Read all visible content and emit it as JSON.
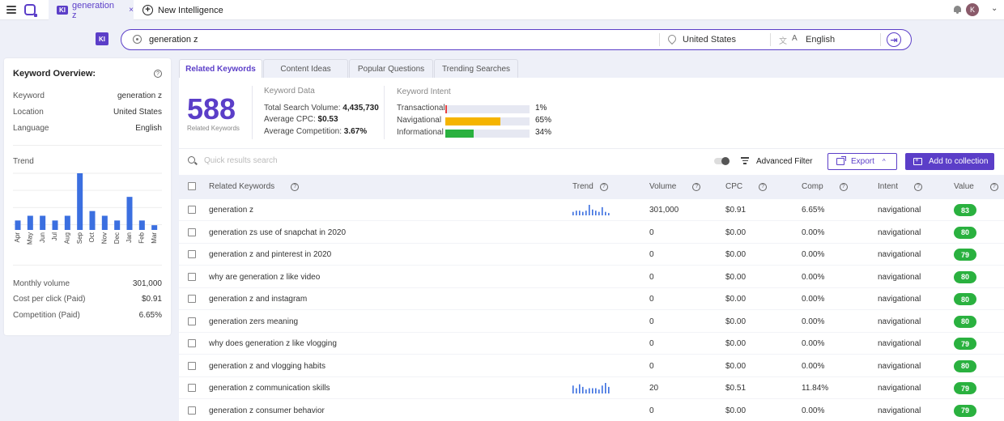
{
  "browser": {
    "active_tab_badge": "KI",
    "active_tab_title": "generation z",
    "active_tab_close": "×",
    "new_tab_label": "New Intelligence",
    "new_tab_icon": "+",
    "user_initial": "K",
    "menu_chevron": "⌄"
  },
  "search": {
    "badge": "KI",
    "query": "generation z",
    "location": "United States",
    "language": "English",
    "go_icon": "⇥"
  },
  "overview": {
    "title": "Keyword Overview:",
    "rows": [
      {
        "label": "Keyword",
        "value": "generation z"
      },
      {
        "label": "Location",
        "value": "United States"
      },
      {
        "label": "Language",
        "value": "English"
      }
    ],
    "trend_label": "Trend",
    "trend_months": [
      "Apr",
      "May",
      "Jun",
      "Jul",
      "Aug",
      "Sep",
      "Oct",
      "Nov",
      "Dec",
      "Jan",
      "Feb",
      "Mar"
    ],
    "trend_values": [
      2,
      3,
      3,
      2,
      3,
      12,
      4,
      3,
      2,
      7,
      2,
      1
    ],
    "stats": [
      {
        "label": "Monthly volume",
        "value": "301,000"
      },
      {
        "label": "Cost per click (Paid)",
        "value": "$0.91"
      },
      {
        "label": "Competition (Paid)",
        "value": "6.65%"
      }
    ]
  },
  "tabs": [
    {
      "label": "Related Keywords",
      "active": true
    },
    {
      "label": "Content Ideas",
      "active": false
    },
    {
      "label": "Popular Questions",
      "active": false
    },
    {
      "label": "Trending Searches",
      "active": false
    }
  ],
  "summary": {
    "count": "588",
    "count_label": "Related Keywords",
    "data_title": "Keyword Data",
    "total_volume_label": "Total Search Volume:",
    "total_volume": "4,435,730",
    "avg_cpc_label": "Average CPC:",
    "avg_cpc": "$0.53",
    "avg_comp_label": "Average Competition:",
    "avg_comp": "3.67%",
    "intent_title": "Keyword Intent",
    "intents": [
      {
        "label": "Transactional",
        "pct": "1%",
        "fraction": 0.01,
        "color": "#e84040"
      },
      {
        "label": "Navigational",
        "pct": "65%",
        "fraction": 0.65,
        "color": "#f5b400"
      },
      {
        "label": "Informational",
        "pct": "34%",
        "fraction": 0.34,
        "color": "#2ab13f"
      }
    ]
  },
  "toolbar": {
    "search_placeholder": "Quick results search",
    "advanced_filter": "Advanced Filter",
    "export": "Export",
    "export_caret": "^",
    "add_collection": "Add to collection"
  },
  "table": {
    "headers": {
      "keyword": "Related Keywords",
      "trend": "Trend",
      "volume": "Volume",
      "cpc": "CPC",
      "comp": "Comp",
      "intent": "Intent",
      "value": "Value"
    },
    "rows": [
      {
        "keyword": "generation z",
        "volume": "301,000",
        "cpc": "$0.91",
        "comp": "6.65%",
        "intent": "navigational",
        "value": "83",
        "trend": [
          3,
          4,
          4,
          3,
          4,
          9,
          5,
          4,
          3,
          7,
          3,
          2
        ]
      },
      {
        "keyword": "generation zs use of snapchat in 2020",
        "volume": "0",
        "cpc": "$0.00",
        "comp": "0.00%",
        "intent": "navigational",
        "value": "80",
        "trend": null
      },
      {
        "keyword": "generation z and pinterest in 2020",
        "volume": "0",
        "cpc": "$0.00",
        "comp": "0.00%",
        "intent": "navigational",
        "value": "79",
        "trend": null
      },
      {
        "keyword": "why are generation z like video",
        "volume": "0",
        "cpc": "$0.00",
        "comp": "0.00%",
        "intent": "navigational",
        "value": "80",
        "trend": null
      },
      {
        "keyword": "generation z and instagram",
        "volume": "0",
        "cpc": "$0.00",
        "comp": "0.00%",
        "intent": "navigational",
        "value": "80",
        "trend": null
      },
      {
        "keyword": "generation zers meaning",
        "volume": "0",
        "cpc": "$0.00",
        "comp": "0.00%",
        "intent": "navigational",
        "value": "80",
        "trend": null
      },
      {
        "keyword": "why does generation z like vlogging",
        "volume": "0",
        "cpc": "$0.00",
        "comp": "0.00%",
        "intent": "navigational",
        "value": "79",
        "trend": null
      },
      {
        "keyword": "generation z and vlogging habits",
        "volume": "0",
        "cpc": "$0.00",
        "comp": "0.00%",
        "intent": "navigational",
        "value": "80",
        "trend": null
      },
      {
        "keyword": "generation z communication skills",
        "volume": "20",
        "cpc": "$0.51",
        "comp": "11.84%",
        "intent": "navigational",
        "value": "79",
        "trend": [
          6,
          4,
          7,
          5,
          3,
          4,
          4,
          4,
          3,
          6,
          8,
          5
        ]
      },
      {
        "keyword": "generation z consumer behavior",
        "volume": "0",
        "cpc": "$0.00",
        "comp": "0.00%",
        "intent": "navigational",
        "value": "79",
        "trend": null
      }
    ]
  },
  "colors": {
    "accent": "#5b3ec8",
    "bar": "#3b6fe0",
    "value_badge": "#2ab13f"
  }
}
